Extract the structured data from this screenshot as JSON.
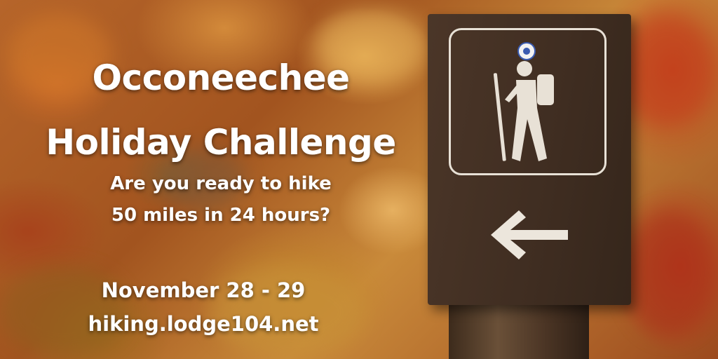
{
  "poster": {
    "title_line1": "Occoneechee",
    "title_line2": "Holiday Challenge",
    "subtitle_line1": "Are you ready to hike",
    "subtitle_line2": "50 miles in 24 hours?",
    "date": "November 28 - 29",
    "website": "hiking.lodge104.net"
  },
  "sign": {
    "icons": [
      "hiker-icon",
      "left-arrow-icon",
      "badge-icon"
    ]
  },
  "colors": {
    "text": "#ffffff",
    "sign": "#3f2d21",
    "sign_border": "#e8e1d6",
    "badge_accent": "#3a5bb0",
    "foliage": "#b6652a"
  }
}
